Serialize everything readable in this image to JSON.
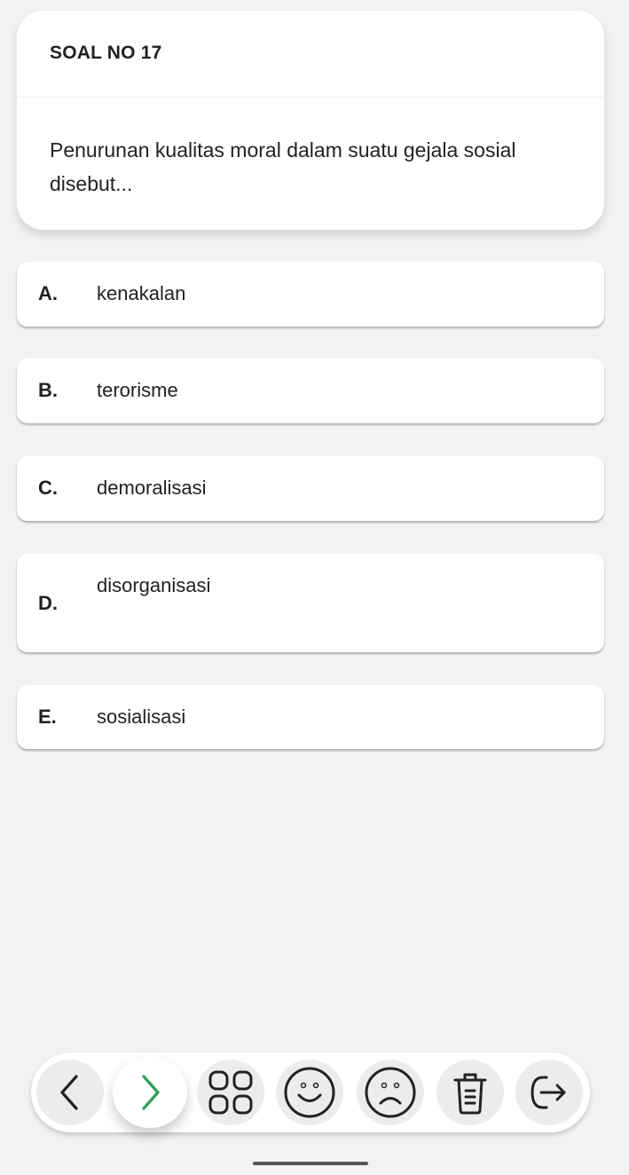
{
  "question": {
    "header": "SOAL NO 17",
    "text": "Penurunan kualitas moral dalam suatu gejala sosial disebut..."
  },
  "options": [
    {
      "letter": "A.",
      "text": "kenakalan"
    },
    {
      "letter": "B.",
      "text": "terorisme"
    },
    {
      "letter": "C.",
      "text": "demoralisasi"
    },
    {
      "letter": "D.",
      "text": "disorganisasi"
    },
    {
      "letter": "E.",
      "text": "sosialisasi"
    }
  ],
  "toolbar": {
    "buttons": [
      {
        "icon": "chevron-left-icon"
      },
      {
        "icon": "chevron-right-icon",
        "color": "#2e9e5b"
      },
      {
        "icon": "grid-icon"
      },
      {
        "icon": "smile-face-icon"
      },
      {
        "icon": "sad-face-icon"
      },
      {
        "icon": "trash-icon"
      },
      {
        "icon": "exit-icon"
      }
    ]
  },
  "colors": {
    "background": "#f2f2f2",
    "card": "#ffffff",
    "accent": "#2e9e5b"
  }
}
